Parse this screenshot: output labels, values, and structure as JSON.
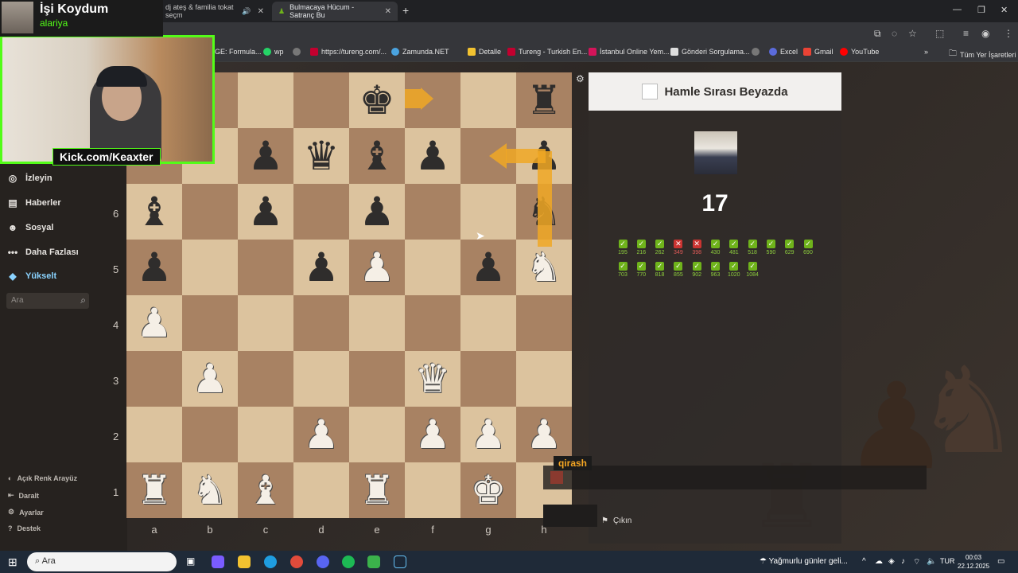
{
  "browser": {
    "tabs": [
      {
        "label": "dj ateş & familia tokat seçm",
        "active": false
      },
      {
        "label": "Bulmacaya Hücum - Satranç Bu",
        "active": true
      }
    ],
    "bookmarks": [
      "GE: Formula...",
      "wp",
      "https://tureng.com/...",
      "Zamunda.NET",
      "Detalle",
      "Tureng - Turkish En...",
      "İstanbul Online Yem...",
      "Gönderi Sorgulama...",
      "Excel",
      "Gmail",
      "YouTube"
    ],
    "all_bookmarks": "Tüm Yer İşaretleri"
  },
  "stream": {
    "title": "İşi Koydum",
    "subtitle": "alariya",
    "kick_label": "Kick.com/Keaxter"
  },
  "sidebar": {
    "items": [
      {
        "label": "İzleyin",
        "icon": "binoculars-icon"
      },
      {
        "label": "Haberler",
        "icon": "news-icon"
      },
      {
        "label": "Sosyal",
        "icon": "social-icon"
      },
      {
        "label": "Daha Fazlası",
        "icon": "more-icon"
      },
      {
        "label": "Yükselt",
        "icon": "diamond-icon"
      }
    ],
    "search_placeholder": "Ara",
    "footer": [
      {
        "label": "Açık Renk Arayüz",
        "icon": "half-circle-icon"
      },
      {
        "label": "Daralt",
        "icon": "collapse-icon"
      },
      {
        "label": "Ayarlar",
        "icon": "gear-icon"
      },
      {
        "label": "Destek",
        "icon": "help-icon"
      }
    ]
  },
  "board": {
    "ranks": [
      "1",
      "2",
      "3",
      "4",
      "5",
      "6"
    ],
    "files": [
      "a",
      "b",
      "c",
      "d",
      "e",
      "f",
      "g",
      "h"
    ]
  },
  "panel": {
    "heading": "Hamle Sırası Beyazda",
    "score": "17",
    "results": [
      {
        "value": "195",
        "ok": true
      },
      {
        "value": "216",
        "ok": true
      },
      {
        "value": "262",
        "ok": true
      },
      {
        "value": "349",
        "ok": false
      },
      {
        "value": "398",
        "ok": false
      },
      {
        "value": "430",
        "ok": true
      },
      {
        "value": "481",
        "ok": true
      },
      {
        "value": "518",
        "ok": true
      },
      {
        "value": "590",
        "ok": true
      },
      {
        "value": "629",
        "ok": true
      },
      {
        "value": "690",
        "ok": true
      },
      {
        "value": "703",
        "ok": true
      },
      {
        "value": "770",
        "ok": true
      },
      {
        "value": "818",
        "ok": true
      },
      {
        "value": "855",
        "ok": true
      },
      {
        "value": "902",
        "ok": true
      },
      {
        "value": "963",
        "ok": true
      },
      {
        "value": "1020",
        "ok": true
      },
      {
        "value": "1084",
        "ok": true
      }
    ],
    "exit_label": "Çıkın"
  },
  "chat": {
    "username": "qirash"
  },
  "taskbar": {
    "search_placeholder": "Ara",
    "weather": "Yağmurlu günler geli...",
    "lang": "TUR",
    "time": "00:03",
    "date": "22.12.2025"
  },
  "colors": {
    "kick_green": "#53fc18",
    "arrow": "#f0a824",
    "ok": "#6fb31b",
    "fail": "#ca3431"
  }
}
